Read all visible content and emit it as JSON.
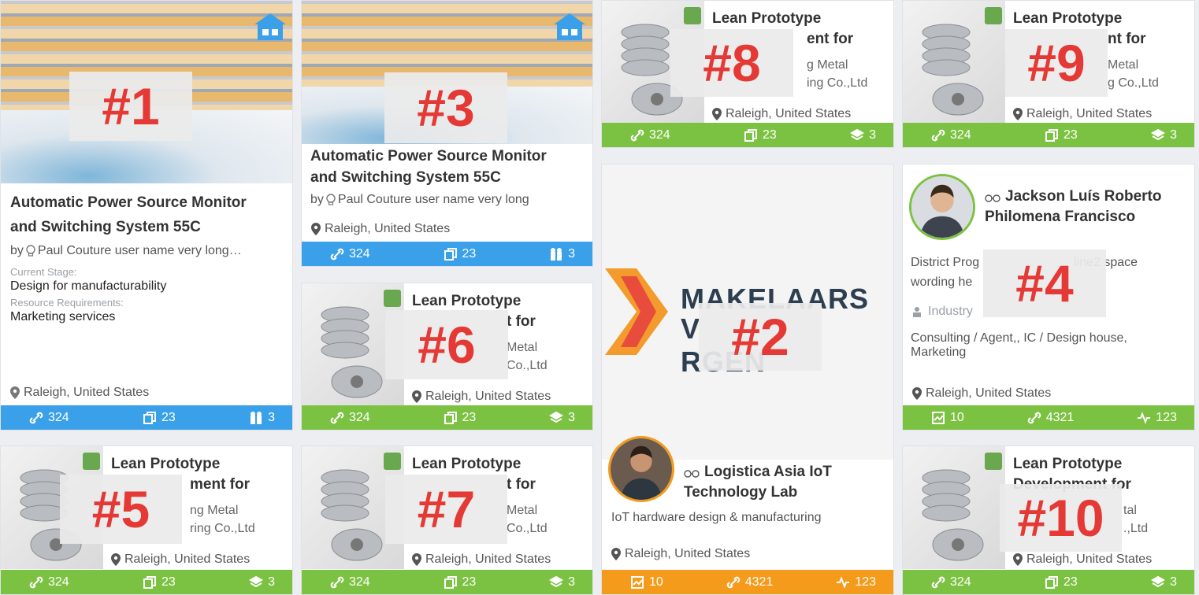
{
  "colors": {
    "green": "#7cc242",
    "blue": "#3aa0ea",
    "orange": "#f59b1c",
    "marker": "#e53935"
  },
  "cards": {
    "c1": {
      "marker": "#1",
      "title_line1": "Automatic Power Source Monitor",
      "title_line2": "and Switching System 55C",
      "by": "by",
      "author": "Paul Couture user name very long…",
      "stage_label": "Current Stage:",
      "stage_value": "Design for manufacturability",
      "resource_label": "Resource Requirements:",
      "resource_value": "Marketing services",
      "location": "Raleigh, United States",
      "stat1": "324",
      "stat2": "23",
      "stat3": "3"
    },
    "c3": {
      "marker": "#3",
      "title_line1": "Automatic Power Source Monitor",
      "title_line2": "and Switching System 55C",
      "by": "by",
      "author": "Paul Couture user name very long",
      "location": "Raleigh, United States",
      "stat1": "324",
      "stat2": "23",
      "stat3": "3"
    },
    "c8": {
      "marker": "#8",
      "title_line1": "Lean Prototype",
      "title_line2": "ent for",
      "company1": "g Metal",
      "company2": "ing Co.,Ltd",
      "location": "Raleigh, United States",
      "stat1": "324",
      "stat2": "23",
      "stat3": "3"
    },
    "c9": {
      "marker": "#9",
      "title_line1": "Lean Prototype",
      "title_line2": "nt for",
      "company1": "Metal",
      "company2": "g Co.,Ltd",
      "location": "Raleigh, United States",
      "stat1": "324",
      "stat2": "23",
      "stat3": "3"
    },
    "c6": {
      "marker": "#6",
      "title_line1": "Lean Prototype",
      "title_line2": "t for",
      "company1": "Metal",
      "company2": "Co.,Ltd",
      "location": "Raleigh, United States",
      "stat1": "324",
      "stat2": "23",
      "stat3": "3"
    },
    "c2": {
      "marker": "#2",
      "logo_line1": "MAKELAARS",
      "logo_line2": "V",
      "logo_line3": "RGEN",
      "name_line1": "Logistica Asia IoT",
      "name_line2": "Technology Lab",
      "description": "IoT hardware design & manufacturing",
      "location": "Raleigh, United States",
      "stat1": "10",
      "stat2": "4321",
      "stat3": "123"
    },
    "c4": {
      "marker": "#4",
      "name_line1": "Jackson Luís Roberto",
      "name_line2": "Philomena Francisco",
      "desc_left1": "District Prog",
      "desc_right1": "line2 space",
      "desc_left2": "wording he",
      "industry": "Industry",
      "tags": "Consulting / Agent,, IC / Design house, Marketing",
      "location": "Raleigh, United States",
      "stat1": "10",
      "stat2": "4321",
      "stat3": "123"
    },
    "c5": {
      "marker": "#5",
      "title_line1": "Lean Prototype",
      "title_line2": "ment for",
      "company1": "ng Metal",
      "company2": "ring Co.,Ltd",
      "location": "Raleigh, United States",
      "stat1": "324",
      "stat2": "23",
      "stat3": "3"
    },
    "c7": {
      "marker": "#7",
      "title_line1": "Lean Prototype",
      "title_line2": "t for",
      "company1": "Metal",
      "company2": "Co.,Ltd",
      "location": "Raleigh, United States",
      "stat1": "324",
      "stat2": "23",
      "stat3": "3"
    },
    "c10": {
      "marker": "#10",
      "title_line1": "Lean Prototype",
      "title_line2": "Development for",
      "company1": "tal",
      "company2": ".,Ltd",
      "location": "Raleigh, United States",
      "stat1": "324",
      "stat2": "23",
      "stat3": "3"
    }
  }
}
